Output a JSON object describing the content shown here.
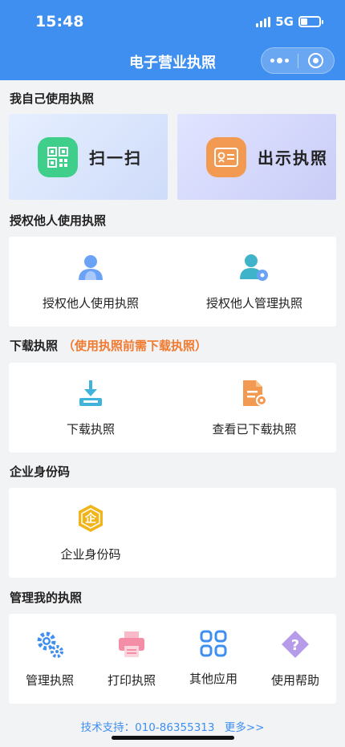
{
  "status": {
    "time": "15:48",
    "network": "5G",
    "battery_level": 0.35
  },
  "nav": {
    "title": "电子营业执照"
  },
  "sections": {
    "self_use": {
      "title": "我自己使用执照",
      "scan_label": "扫一扫",
      "show_label": "出示执照"
    },
    "authorize": {
      "title": "授权他人使用执照",
      "items": [
        {
          "label": "授权他人使用执照"
        },
        {
          "label": "授权他人管理执照"
        }
      ]
    },
    "download": {
      "title": "下载执照",
      "note": "（使用执照前需下载执照）",
      "items": [
        {
          "label": "下载执照"
        },
        {
          "label": "查看已下载执照"
        }
      ]
    },
    "enterprise_id": {
      "title": "企业身份码",
      "items": [
        {
          "label": "企业身份码",
          "badge_char": "企"
        }
      ]
    },
    "manage": {
      "title": "管理我的执照",
      "items": [
        {
          "label": "管理执照"
        },
        {
          "label": "打印执照"
        },
        {
          "label": "其他应用"
        },
        {
          "label": "使用帮助"
        }
      ]
    }
  },
  "footer": {
    "support_text": "技术支持：010-86355313",
    "more_link": "更多>>"
  },
  "colors": {
    "brand": "#3f8ff0",
    "note": "#f07a2f",
    "scan_green": "#3fcf8a",
    "show_orange": "#f39a52",
    "enterprise_gold": "#f1b51c",
    "print_pink": "#f48ea6",
    "help_purple": "#b59bea"
  }
}
